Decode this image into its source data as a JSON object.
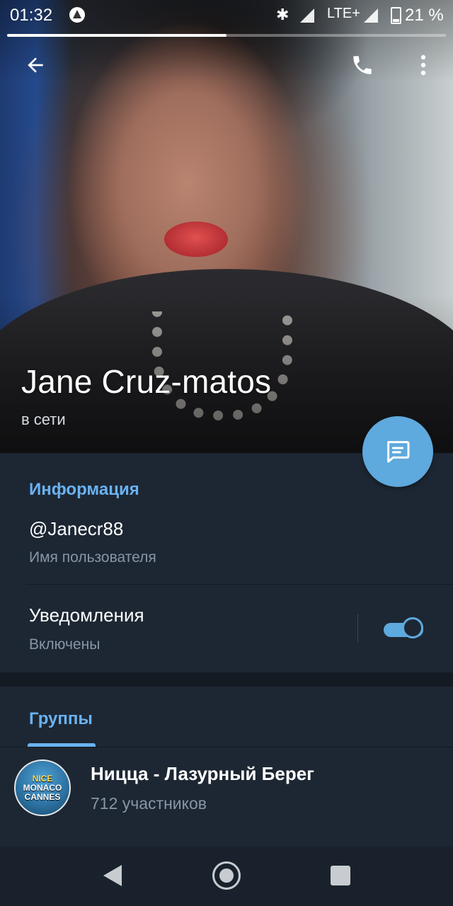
{
  "status_bar": {
    "time": "01:32",
    "network": "LTE+",
    "battery": "21 %"
  },
  "story_progress": 0.5,
  "profile": {
    "name": "Jane Cruz-matos",
    "status": "в сети"
  },
  "info": {
    "section_title": "Информация",
    "username": "@Janecr88",
    "username_label": "Имя пользователя",
    "notifications": "Уведомления",
    "notifications_state": "Включены",
    "notifications_on": true
  },
  "groups": {
    "tab_title": "Группы",
    "items": [
      {
        "name": "Ницца - Лазурный Берег",
        "members": "712 участников",
        "avatar_text": [
          "NICE",
          "MONACO",
          "CANNES"
        ]
      }
    ]
  },
  "colors": {
    "accent": "#5ea9dd",
    "link": "#6ab2f2",
    "background": "#1d2733"
  }
}
